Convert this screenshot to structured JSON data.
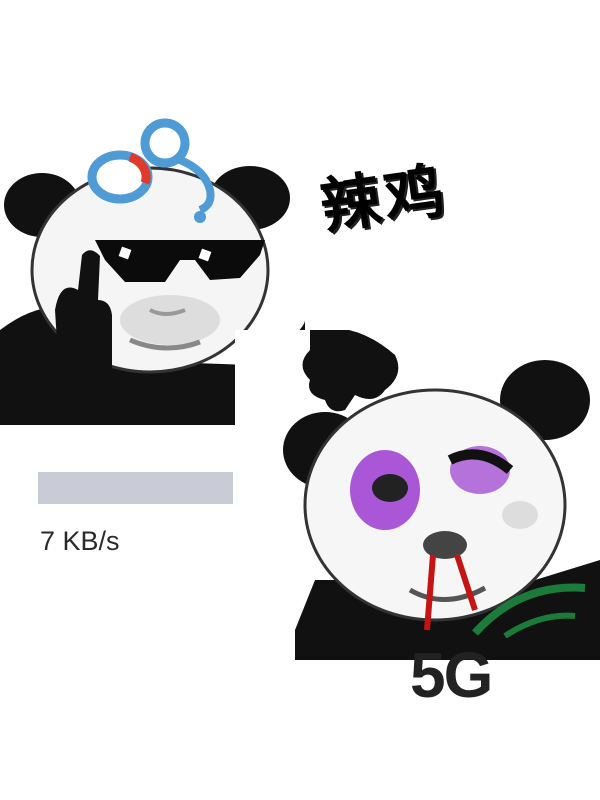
{
  "caption": {
    "text": "辣鸡"
  },
  "progress": {
    "fraction": 1.0,
    "speed_text": "7 KB/s"
  },
  "badge": {
    "text": "5G"
  },
  "colors": {
    "logo_blue": "#4f9bd5",
    "logo_red": "#e03a2d",
    "bruise_purple": "#9b3bd0",
    "blood_red": "#c41414",
    "wave_green": "#1c7a3a",
    "track": "#eef0f4",
    "fill": "#c9ccd6"
  },
  "icons": [
    "360-logo-icon",
    "5g-signal-wave-icon",
    "sunglasses-icon"
  ]
}
